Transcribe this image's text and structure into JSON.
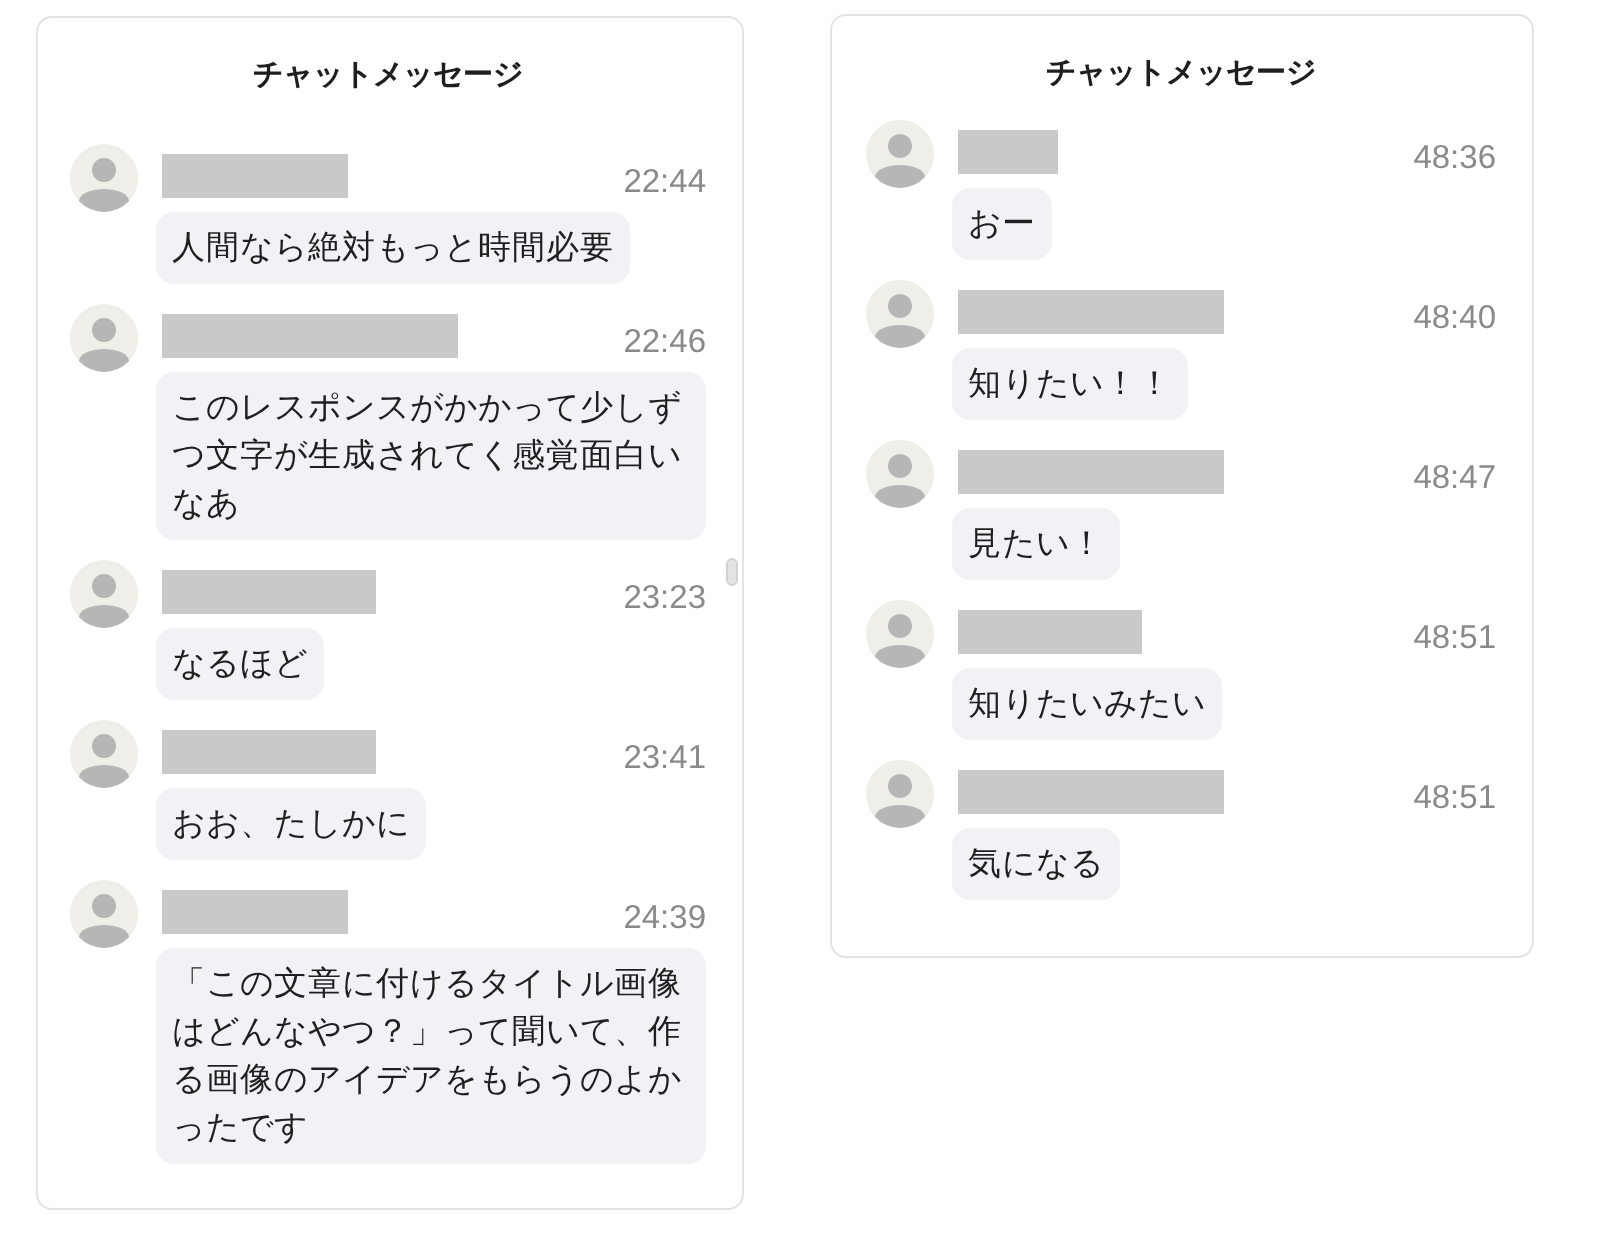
{
  "panels": [
    {
      "title": "チャットメッセージ",
      "scrollable": true,
      "messages": [
        {
          "time": "22:44",
          "text": "人間なら絶対もっと時間必要"
        },
        {
          "time": "22:46",
          "text": "このレスポンスがかかって少しずつ文字が生成されてく感覚面白いなあ"
        },
        {
          "time": "23:23",
          "text": "なるほど"
        },
        {
          "time": "23:41",
          "text": "おお、たしかに"
        },
        {
          "time": "24:39",
          "text": "「この文章に付けるタイトル画像はどんなやつ？」って聞いて、作る画像のアイデアをもらうのよかったです"
        }
      ]
    },
    {
      "title": "チャットメッセージ",
      "scrollable": false,
      "messages": [
        {
          "time": "48:36",
          "text": "おー"
        },
        {
          "time": "48:40",
          "text": "知りたい！！"
        },
        {
          "time": "48:47",
          "text": "見たい！"
        },
        {
          "time": "48:51",
          "text": "知りたいみたい"
        },
        {
          "time": "48:51",
          "text": "気になる"
        }
      ]
    }
  ]
}
